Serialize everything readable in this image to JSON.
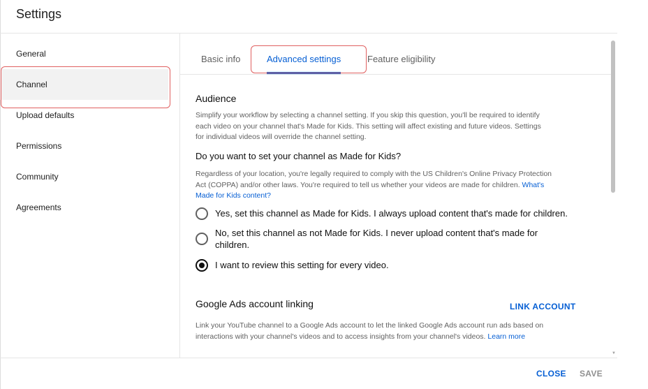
{
  "dialog": {
    "title": "Settings"
  },
  "sidebar": {
    "items": [
      {
        "label": "General"
      },
      {
        "label": "Channel"
      },
      {
        "label": "Upload defaults"
      },
      {
        "label": "Permissions"
      },
      {
        "label": "Community"
      },
      {
        "label": "Agreements"
      }
    ],
    "active": "Channel"
  },
  "tabs": [
    {
      "label": "Basic info"
    },
    {
      "label": "Advanced settings"
    },
    {
      "label": "Feature eligibility"
    }
  ],
  "active_tab": "Advanced settings",
  "audience": {
    "heading": "Audience",
    "description_1": "Simplify your workflow by selecting a channel setting. If you skip this question, you'll be required to identify",
    "description_2": "each video on your channel that's Made for Kids. This setting will affect existing and future videos. Settings",
    "description_3": "for individual videos will override the channel setting.",
    "question": "Do you want to set your channel as Made for Kids?",
    "legal_1": "Regardless of your location, you're legally required to comply with the US Children's Online Privacy Protection",
    "legal_2": "Act (COPPA) and/or other laws. You're required to tell us whether your videos are made for children.",
    "legal_link_1": "What's",
    "legal_link_2": "Made for Kids content?",
    "options": [
      {
        "label": "Yes, set this channel as Made for Kids. I always upload content that's made for children.",
        "checked": false
      },
      {
        "label_1": "No, set this channel as not Made for Kids. I never upload content that's made for",
        "label_2": "children.",
        "checked": false
      },
      {
        "label": "I want to review this setting for every video.",
        "checked": true
      }
    ]
  },
  "ads": {
    "heading": "Google Ads account linking",
    "action": "LINK ACCOUNT",
    "description_1": "Link your YouTube channel to a Google Ads account to let the linked Google Ads account run ads based on",
    "description_2": "interactions with your channel's videos and to access insights from your channel's videos.",
    "learn_more": "Learn more"
  },
  "footer": {
    "close": "CLOSE",
    "save": "SAVE"
  },
  "colors": {
    "accent": "#065fd4",
    "highlight": "#e06060",
    "active_bg": "#f2f2f2"
  }
}
